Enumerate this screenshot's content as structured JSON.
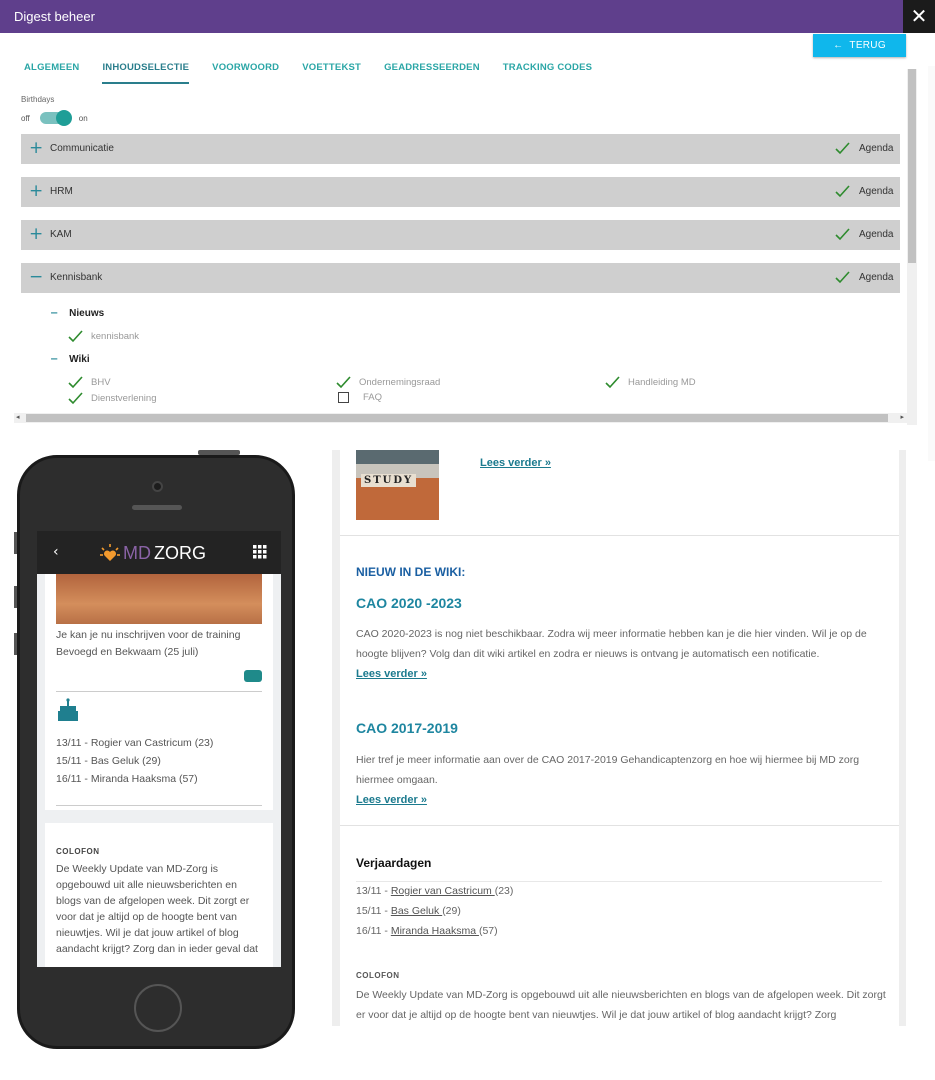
{
  "window": {
    "title": "Digest beheer",
    "close_icon": "close-icon"
  },
  "admin": {
    "back_button": "TERUG",
    "tabs": [
      "ALGEMEEN",
      "INHOUDSELECTIE",
      "VOORWOORD",
      "VOETTEKST",
      "GEADRESSEERDEN",
      "TRACKING CODES"
    ],
    "active_tab": "INHOUDSELECTIE",
    "birthdays": {
      "label": "Birthdays",
      "off": "off",
      "on": "on",
      "state": "on"
    },
    "rows": [
      {
        "label": "Communicatie",
        "expanded": false,
        "tag": "Agenda"
      },
      {
        "label": "HRM",
        "expanded": false,
        "tag": "Agenda"
      },
      {
        "label": "KAM",
        "expanded": false,
        "tag": "Agenda"
      },
      {
        "label": "Kennisbank",
        "expanded": true,
        "tag": "Agenda"
      }
    ],
    "kennisbank": {
      "nieuws": {
        "label": "Nieuws",
        "items": [
          {
            "label": "kennisbank",
            "checked": true
          }
        ]
      },
      "wiki": {
        "label": "Wiki",
        "items": [
          {
            "label": "BHV",
            "checked": true
          },
          {
            "label": "Ondernemingsraad",
            "checked": true
          },
          {
            "label": "Handleiding MD",
            "checked": true
          },
          {
            "label": "Dienstverlening",
            "checked": true
          },
          {
            "label": "FAQ",
            "checked": false
          }
        ]
      }
    },
    "colors": {
      "titlebar": "#5f3f8c",
      "accent": "#2a8a9a",
      "button": "#0fb7ec",
      "check": "#2e8b2e"
    }
  },
  "phone": {
    "brand_md": "MD",
    "brand_zorg": "ZORG",
    "training_text": "Je kan je nu inschrijven voor de training Bevoegd en Bekwaam (25 juli)",
    "birthdays": [
      "13/11 - Rogier van Castricum (23)",
      "15/11 - Bas Geluk (29)",
      "16/11 - Miranda Haaksma (57)"
    ],
    "colofon_head": "COLOFON",
    "colofon_text": "De Weekly Update van MD-Zorg is opgebouwd uit alle nieuwsberichten en blogs  van de afgelopen week. Dit zorgt er voor dat je altijd op de hoogte bent van nieuwtjes. Wil je dat jouw artikel of blog aandacht krijgt? Zorg dan in ieder geval dat"
  },
  "preview": {
    "study_word": "STUDY",
    "read_more": "Lees verder »",
    "wiki_section": "NIEUW IN DE WIKI:",
    "articles": [
      {
        "title": "CAO 2020 -2023",
        "text": "CAO 2020-2023 is nog niet beschikbaar. Zodra wij meer informatie hebben kan je die hier vinden. Wil je op de hoogte blijven? Volg dan dit wiki artikel en zodra er nieuws is ontvang je automatisch een notificatie."
      },
      {
        "title": "CAO 2017-2019",
        "text": "Hier tref je meer informatie aan over de CAO 2017-2019 Gehandicaptenzorg en hoe wij hiermee bij MD zorg hiermee omgaan."
      }
    ],
    "birthdays_head": "Verjaardagen",
    "birthdays": [
      {
        "date": "13/11 - ",
        "name": "Rogier van Castricum ",
        "age": "(23)"
      },
      {
        "date": "15/11 - ",
        "name": "Bas Geluk ",
        "age": "(29)"
      },
      {
        "date": "16/11 - ",
        "name": "Miranda Haaksma ",
        "age": "(57)"
      }
    ],
    "colofon_head": "COLOFON",
    "colofon_text": "De Weekly Update van MD-Zorg is opgebouwd uit alle nieuwsberichten en blogs  van de afgelopen week. Dit zorgt er voor dat je altijd op de hoogte bent van nieuwtjes. Wil je dat jouw artikel of blog aandacht krijgt? Zorg"
  }
}
